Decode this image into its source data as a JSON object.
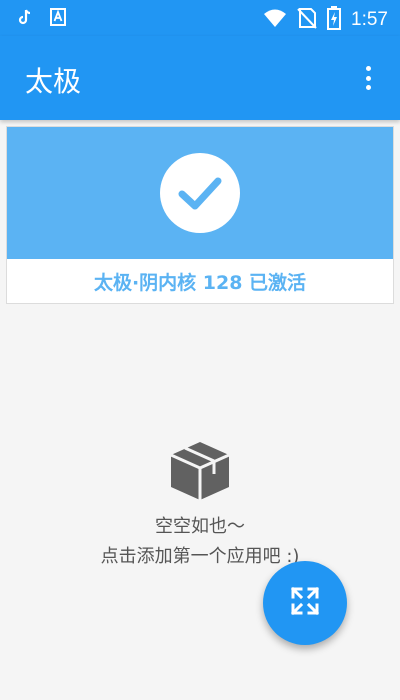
{
  "status_bar": {
    "time": "1:57",
    "icons": [
      "tiktok-icon",
      "a-app-icon",
      "wifi-icon",
      "signal-off-icon",
      "battery-charging-icon"
    ]
  },
  "app_bar": {
    "title": "太极",
    "menu_icon": "more-vert-icon"
  },
  "status_card": {
    "icon": "check-icon",
    "text": "太极·阴内核 128 已激活",
    "accent_color": "#5bb3f3"
  },
  "empty_state": {
    "icon": "package-box-icon",
    "line1": "空空如也～",
    "line2": "点击添加第一个应用吧 :)"
  },
  "fab": {
    "icon": "expand-arrows-icon"
  },
  "colors": {
    "primary": "#2196f3",
    "background": "#f5f5f5"
  }
}
